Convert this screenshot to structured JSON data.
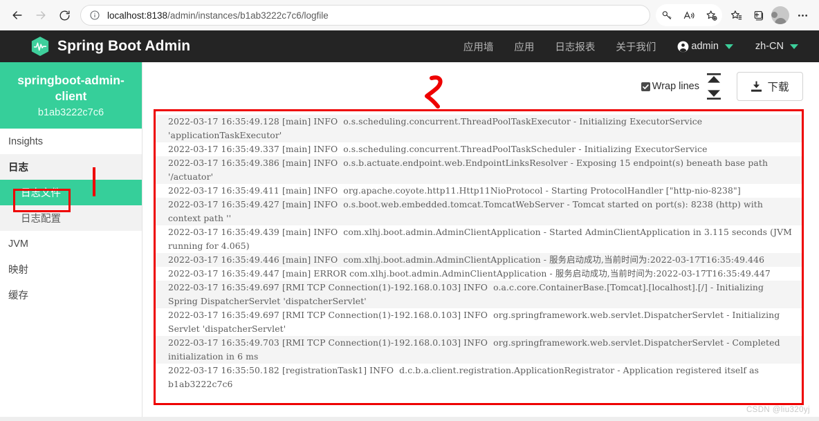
{
  "browser": {
    "back_icon": "back-arrow-icon",
    "forward_icon": "forward-arrow-icon",
    "reload_icon": "reload-icon",
    "info_icon": "info-icon",
    "url_host": "localhost:8138",
    "url_path": "/admin/instances/b1ab3222c7c6/logfile",
    "url_full": "localhost:8138/admin/instances/b1ab3222c7c6/logfile",
    "actions": [
      {
        "name": "password-key-icon"
      },
      {
        "name": "read-aloud-icon"
      },
      {
        "name": "add-favorite-icon"
      },
      {
        "name": "favorites-icon"
      },
      {
        "name": "collections-icon"
      },
      {
        "name": "profile-avatar-icon"
      },
      {
        "name": "settings-more-icon"
      }
    ]
  },
  "header": {
    "logo_icon": "spring-boot-admin-logo",
    "title": "Spring Boot Admin",
    "nav": [
      {
        "label": "应用墙"
      },
      {
        "label": "应用"
      },
      {
        "label": "日志报表"
      },
      {
        "label": "关于我们"
      }
    ],
    "user": {
      "icon": "user-circle-icon",
      "label": "admin",
      "caret": "chevron-down-icon"
    },
    "lang": {
      "label": "zh-CN",
      "caret": "chevron-down-icon"
    },
    "accent_color": "#3ccf9a",
    "background_color": "#242424"
  },
  "sidebar": {
    "instance": {
      "name": "springboot-admin-client",
      "id": "b1ab3222c7c6",
      "background_color": "#36cf9a"
    },
    "items": [
      {
        "label": "Insights",
        "type": "plain"
      },
      {
        "label": "日志",
        "type": "group"
      },
      {
        "label": "日志文件",
        "type": "active"
      },
      {
        "label": "日志配置",
        "type": "sub"
      },
      {
        "label": "JVM",
        "type": "plain"
      },
      {
        "label": "映射",
        "type": "plain"
      },
      {
        "label": "缓存",
        "type": "plain"
      }
    ]
  },
  "toolbar": {
    "wrap_lines_label": "Wrap lines",
    "wrap_lines_checked": true,
    "checkbox_icon": "checkbox-checked-icon",
    "scroll_top_icon": "scroll-to-top-icon",
    "scroll_bottom_icon": "scroll-to-bottom-icon",
    "download_label": "下载",
    "download_icon": "download-icon"
  },
  "annotations": {
    "marker_label": "2",
    "marker_color": "#ee0000",
    "box_color": "#ee0000"
  },
  "log": {
    "lines": [
      "2022-03-17 16:35:49.128 [main] INFO  o.s.scheduling.concurrent.ThreadPoolTaskExecutor - Initializing ExecutorService 'applicationTaskExecutor'",
      "2022-03-17 16:35:49.337 [main] INFO  o.s.scheduling.concurrent.ThreadPoolTaskScheduler - Initializing ExecutorService",
      "2022-03-17 16:35:49.386 [main] INFO  o.s.b.actuate.endpoint.web.EndpointLinksResolver - Exposing 15 endpoint(s) beneath base path '/actuator'",
      "2022-03-17 16:35:49.411 [main] INFO  org.apache.coyote.http11.Http11NioProtocol - Starting ProtocolHandler [\"http-nio-8238\"]",
      "2022-03-17 16:35:49.427 [main] INFO  o.s.boot.web.embedded.tomcat.TomcatWebServer - Tomcat started on port(s): 8238 (http) with context path ''",
      "2022-03-17 16:35:49.439 [main] INFO  com.xlhj.boot.admin.AdminClientApplication - Started AdminClientApplication in 3.115 seconds (JVM running for 4.065)",
      "2022-03-17 16:35:49.446 [main] INFO  com.xlhj.boot.admin.AdminClientApplication - 服务启动成功,当前时间为:2022-03-17T16:35:49.446",
      "2022-03-17 16:35:49.447 [main] ERROR com.xlhj.boot.admin.AdminClientApplication - 服务启动成功,当前时间为:2022-03-17T16:35:49.447",
      "2022-03-17 16:35:49.697 [RMI TCP Connection(1)-192.168.0.103] INFO  o.a.c.core.ContainerBase.[Tomcat].[localhost].[/] - Initializing Spring DispatcherServlet 'dispatcherServlet'",
      "2022-03-17 16:35:49.697 [RMI TCP Connection(1)-192.168.0.103] INFO  org.springframework.web.servlet.DispatcherServlet - Initializing Servlet 'dispatcherServlet'",
      "2022-03-17 16:35:49.703 [RMI TCP Connection(1)-192.168.0.103] INFO  org.springframework.web.servlet.DispatcherServlet - Completed initialization in 6 ms",
      "2022-03-17 16:35:50.182 [registrationTask1] INFO  d.c.b.a.client.registration.ApplicationRegistrator - Application registered itself as b1ab3222c7c6"
    ]
  },
  "watermark": {
    "text": "CSDN @liu320yj"
  }
}
